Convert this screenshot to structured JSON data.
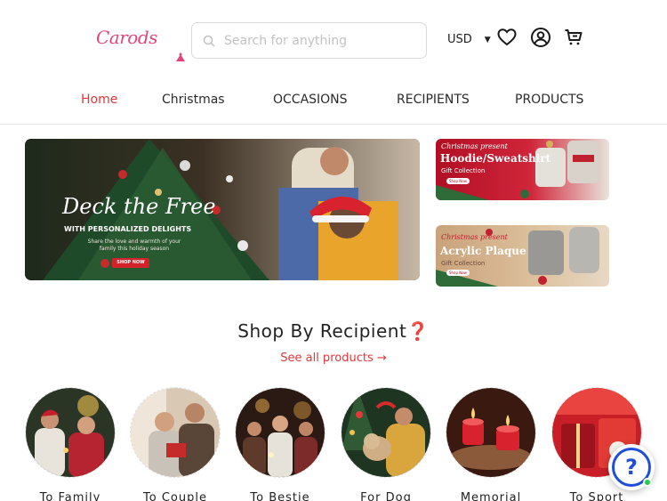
{
  "header": {
    "logo_text": "Carods",
    "search_placeholder": "Search for anything",
    "currency": "USD"
  },
  "nav": {
    "items": [
      {
        "label": "Home",
        "active": true
      },
      {
        "label": "Christmas",
        "active": false
      },
      {
        "label": "OCCASIONS",
        "active": false
      },
      {
        "label": "RECIPIENTS",
        "active": false
      },
      {
        "label": "PRODUCTS",
        "active": false
      }
    ]
  },
  "hero": {
    "title": "Deck the Free",
    "subtitle": "WITH PERSONALIZED DELIGHTS",
    "copy": "Share the love and warmth of your family this holiday season",
    "button": "SHOP NOW"
  },
  "side_banners": [
    {
      "kicker": "Christmas present",
      "title": "Hoodie/Sweatshirt",
      "sub": "Gift Collection",
      "button": "Shop Now"
    },
    {
      "kicker": "Christmas present",
      "title": "Acrylic Plaque",
      "sub": "Gift Collection",
      "button": "Shop Now"
    }
  ],
  "section": {
    "title": "Shop By Recipient❓",
    "see_all": "See all products →"
  },
  "recipients": [
    {
      "label": "To Family",
      "icon": "family-photo"
    },
    {
      "label": "To Couple",
      "icon": "couple-photo"
    },
    {
      "label": "To Bestie",
      "icon": "bestie-photo"
    },
    {
      "label": "For Dog",
      "icon": "dog-photo"
    },
    {
      "label": "Memorial",
      "icon": "memorial-candles-photo"
    },
    {
      "label": "To Sport",
      "icon": "sport-photo"
    }
  ],
  "help": {
    "symbol": "?"
  },
  "colors": {
    "brand": "#e0457b",
    "accent_red": "#e0373b",
    "help_blue": "#1f4fd8",
    "online_green": "#1fcf4a"
  }
}
